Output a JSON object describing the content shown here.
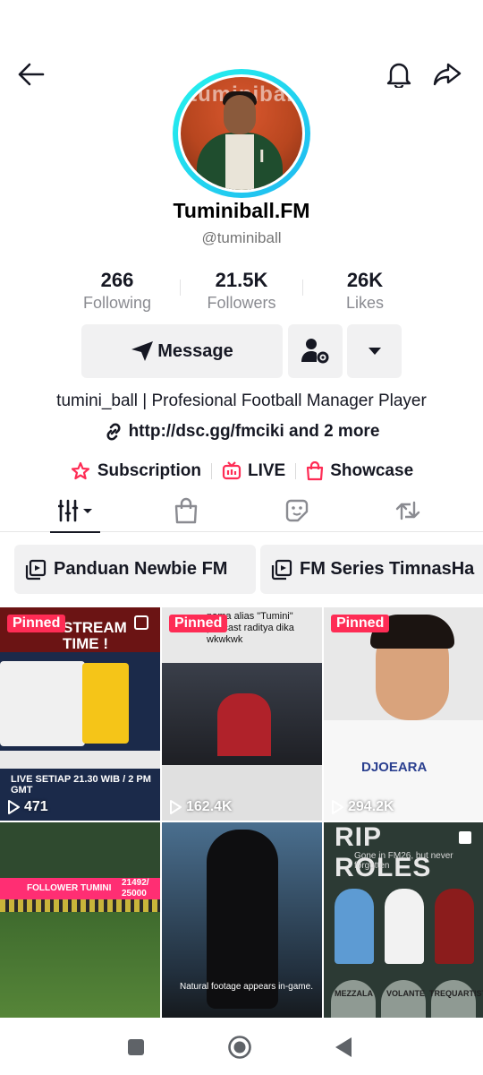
{
  "profile": {
    "display_name": "Tuminiball.FM",
    "handle": "@tuminiball",
    "avatar_logo_text": "tuminibal",
    "bio": "tumini_ball | Profesional Football Manager Player",
    "link": "http://dsc.gg/fmciki and 2 more"
  },
  "stats": {
    "following_count": "266",
    "following_label": "Following",
    "followers_count": "21.5K",
    "followers_label": "Followers",
    "likes_count": "26K",
    "likes_label": "Likes"
  },
  "actions": {
    "message_label": "Message"
  },
  "chips": {
    "subscription": "Subscription",
    "live": "LIVE",
    "showcase": "Showcase"
  },
  "playlists": [
    {
      "label": "Panduan Newbie FM"
    },
    {
      "label": "FM Series TimnasHa"
    }
  ],
  "videos": [
    {
      "pinned_label": "Pinned",
      "views": "471",
      "overlay_title": "STREAM TIME !",
      "overlay_sub": "LIVE SETIAP 21.30 WIB / 2 PM GMT"
    },
    {
      "pinned_label": "Pinned",
      "views": "162.4K",
      "overlay_title": "nama alias \"Tumini\" podcast raditya dika wkwkwk"
    },
    {
      "pinned_label": "Pinned",
      "views": "294.2K",
      "overlay_title": "DJOEARA"
    },
    {
      "views": "",
      "overlay_title": "FOLLOWER TUMINI",
      "overlay_sub": "21492/ 25000"
    },
    {
      "views": "",
      "overlay_title": "Natural footage appears in-game."
    },
    {
      "views": "",
      "overlay_title": "RIP ROLES",
      "overlay_sub": "Gone in FM26, but never forgotten",
      "roles": [
        "MEZZALA",
        "VOLANTE",
        "TREQUARTISTA"
      ]
    }
  ],
  "colors": {
    "accent_red": "#fe2c55",
    "avatar_ring": "#25f4ee",
    "text_primary": "#161823",
    "text_secondary": "#8a8b91"
  }
}
